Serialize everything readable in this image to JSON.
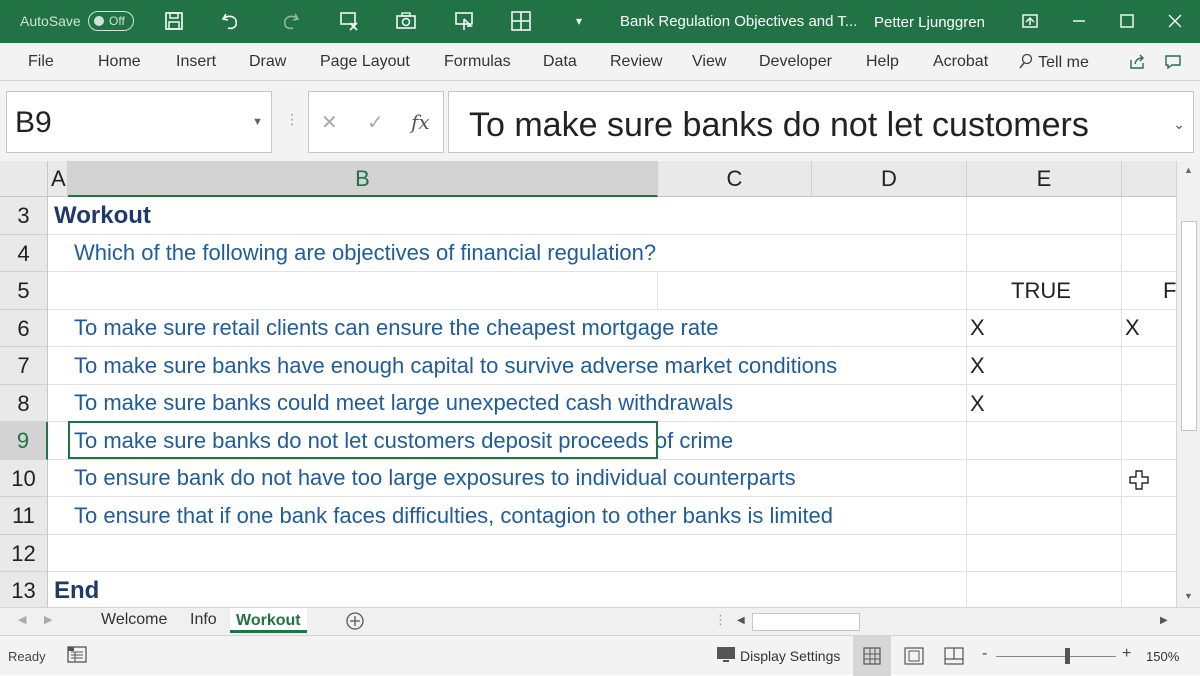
{
  "titlebar": {
    "autosave_label": "AutoSave",
    "autosave_state": "Off",
    "doc_title": "Bank Regulation Objectives and T...",
    "user": "Petter Ljunggren",
    "color": "#217346"
  },
  "ribbon": {
    "tabs": [
      "File",
      "Home",
      "Insert",
      "Draw",
      "Page Layout",
      "Formulas",
      "Data",
      "Review",
      "View",
      "Developer",
      "Help",
      "Acrobat",
      "Tell me"
    ]
  },
  "formula_bar": {
    "name_box": "B9",
    "fx": "fx",
    "content": "To make sure banks do not let customers"
  },
  "columns": [
    "A",
    "B",
    "C",
    "D",
    "E"
  ],
  "partial_column_label": "F",
  "rows": [
    "3",
    "4",
    "5",
    "6",
    "7",
    "8",
    "9",
    "10",
    "11",
    "12",
    "13"
  ],
  "cells": {
    "a3": "Workout",
    "b4": "Which of the following are objectives of financial regulation?",
    "e5": "TRUE",
    "f5": "F",
    "b6": "To make sure retail clients can ensure the cheapest mortgage rate",
    "d6": "X",
    "f6": "X",
    "b7": "To make sure banks have enough capital to survive adverse market conditions",
    "d7": "X",
    "b8": "To make sure banks could meet large unexpected cash withdrawals",
    "d8": "X",
    "b9": "To make sure banks do not let customers deposit proceeds of crime",
    "b10": "To ensure bank do not have too large exposures to individual counterparts",
    "b11": "To ensure that if one bank faces difficulties, contagion to other banks is limited",
    "a13": "End"
  },
  "sheets": [
    "Welcome",
    "Info",
    "Workout"
  ],
  "active_sheet": "Workout",
  "status": {
    "ready": "Ready",
    "display_settings": "Display Settings",
    "zoom": "150%",
    "zoom_minus": "-",
    "zoom_plus": "+"
  }
}
